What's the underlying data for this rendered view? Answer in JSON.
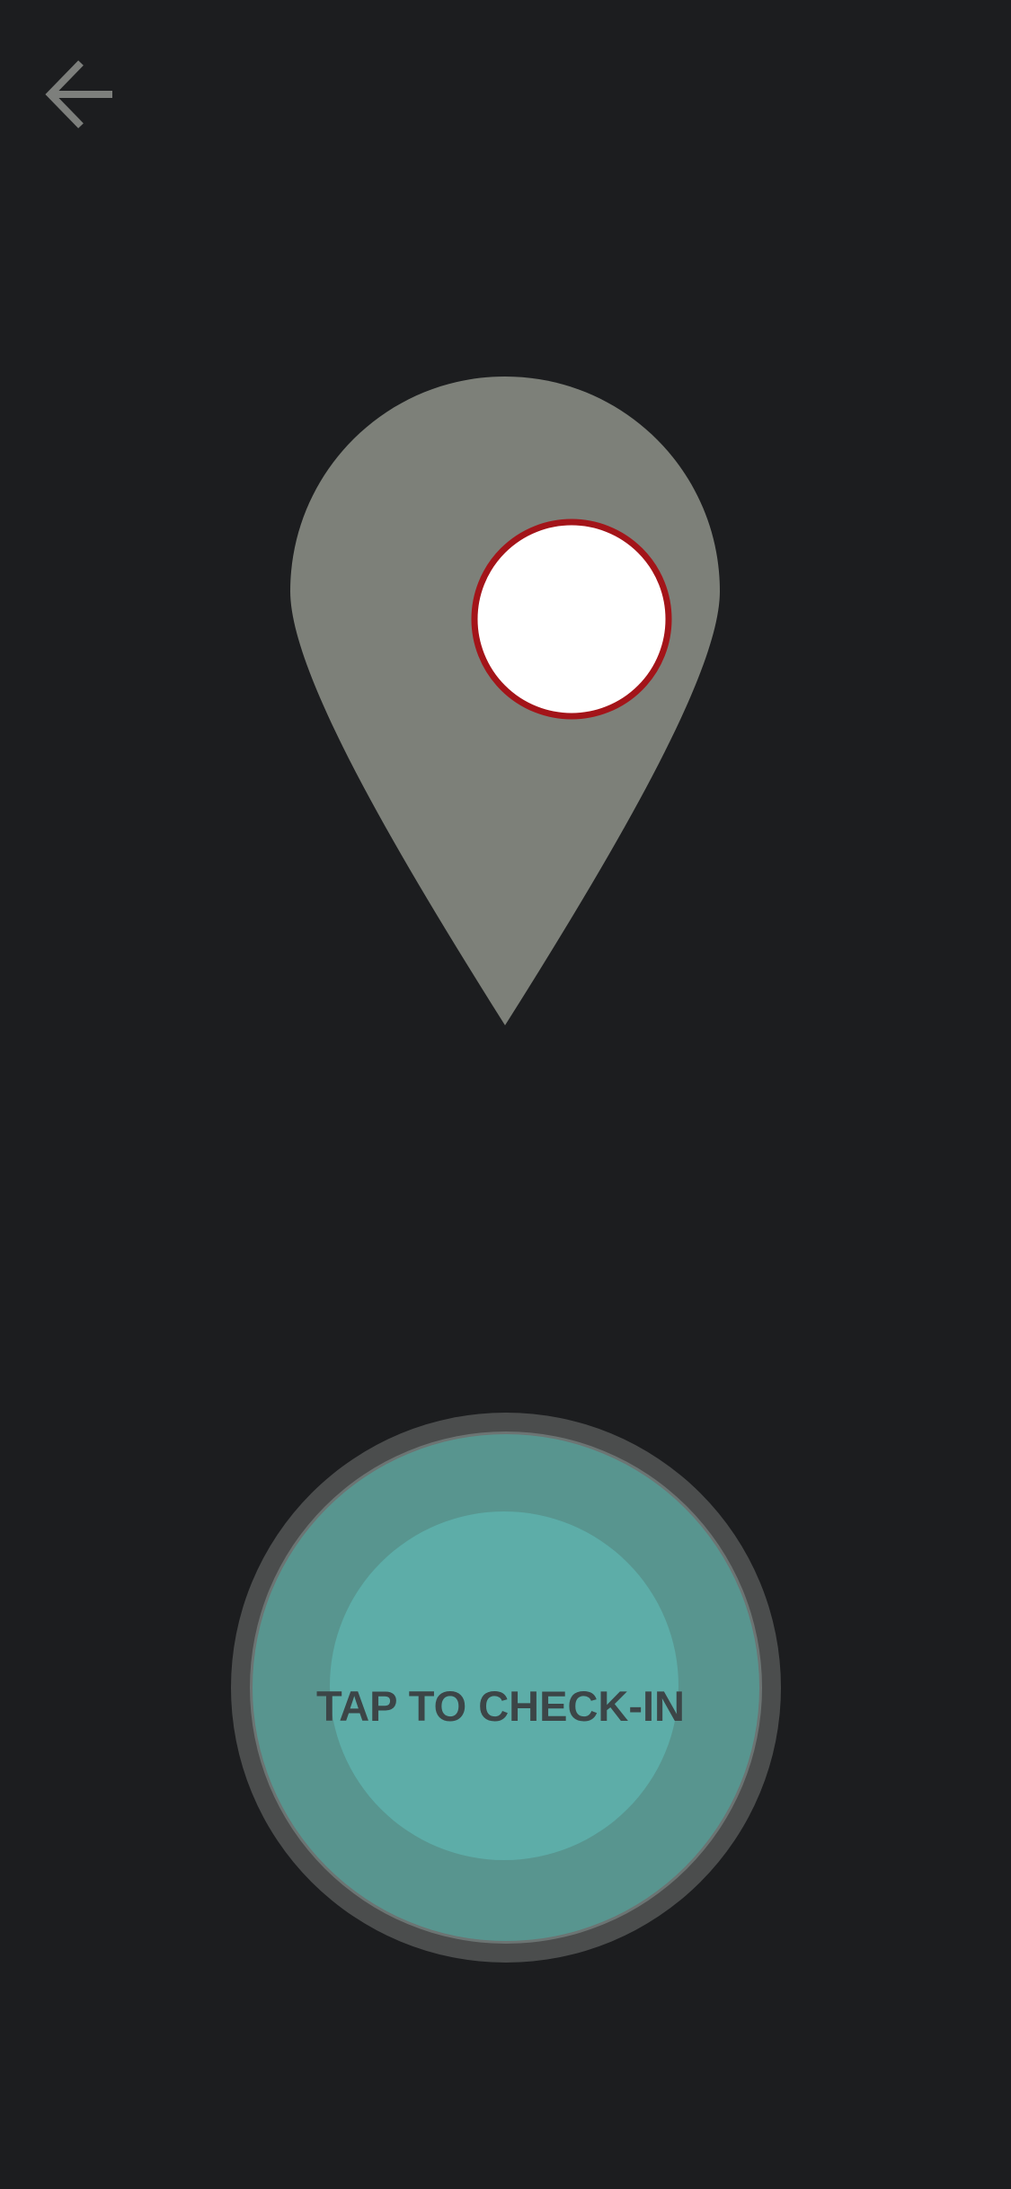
{
  "nav": {
    "back_icon": "arrow-left-icon"
  },
  "location_pin": {
    "icon": "map-pin-icon",
    "pin_color": "#7d8079",
    "dot_color": "#ffffff",
    "dot_ring_color": "#a31419"
  },
  "checkin": {
    "label": "TAP TO CHECK-IN",
    "colors": {
      "ring": "#4b4d4d",
      "outer": "#58958f",
      "inner": "#5dada8",
      "text": "#3c4547"
    }
  },
  "colors": {
    "background": "#1c1d1f",
    "icon": "#7d7f7c"
  }
}
